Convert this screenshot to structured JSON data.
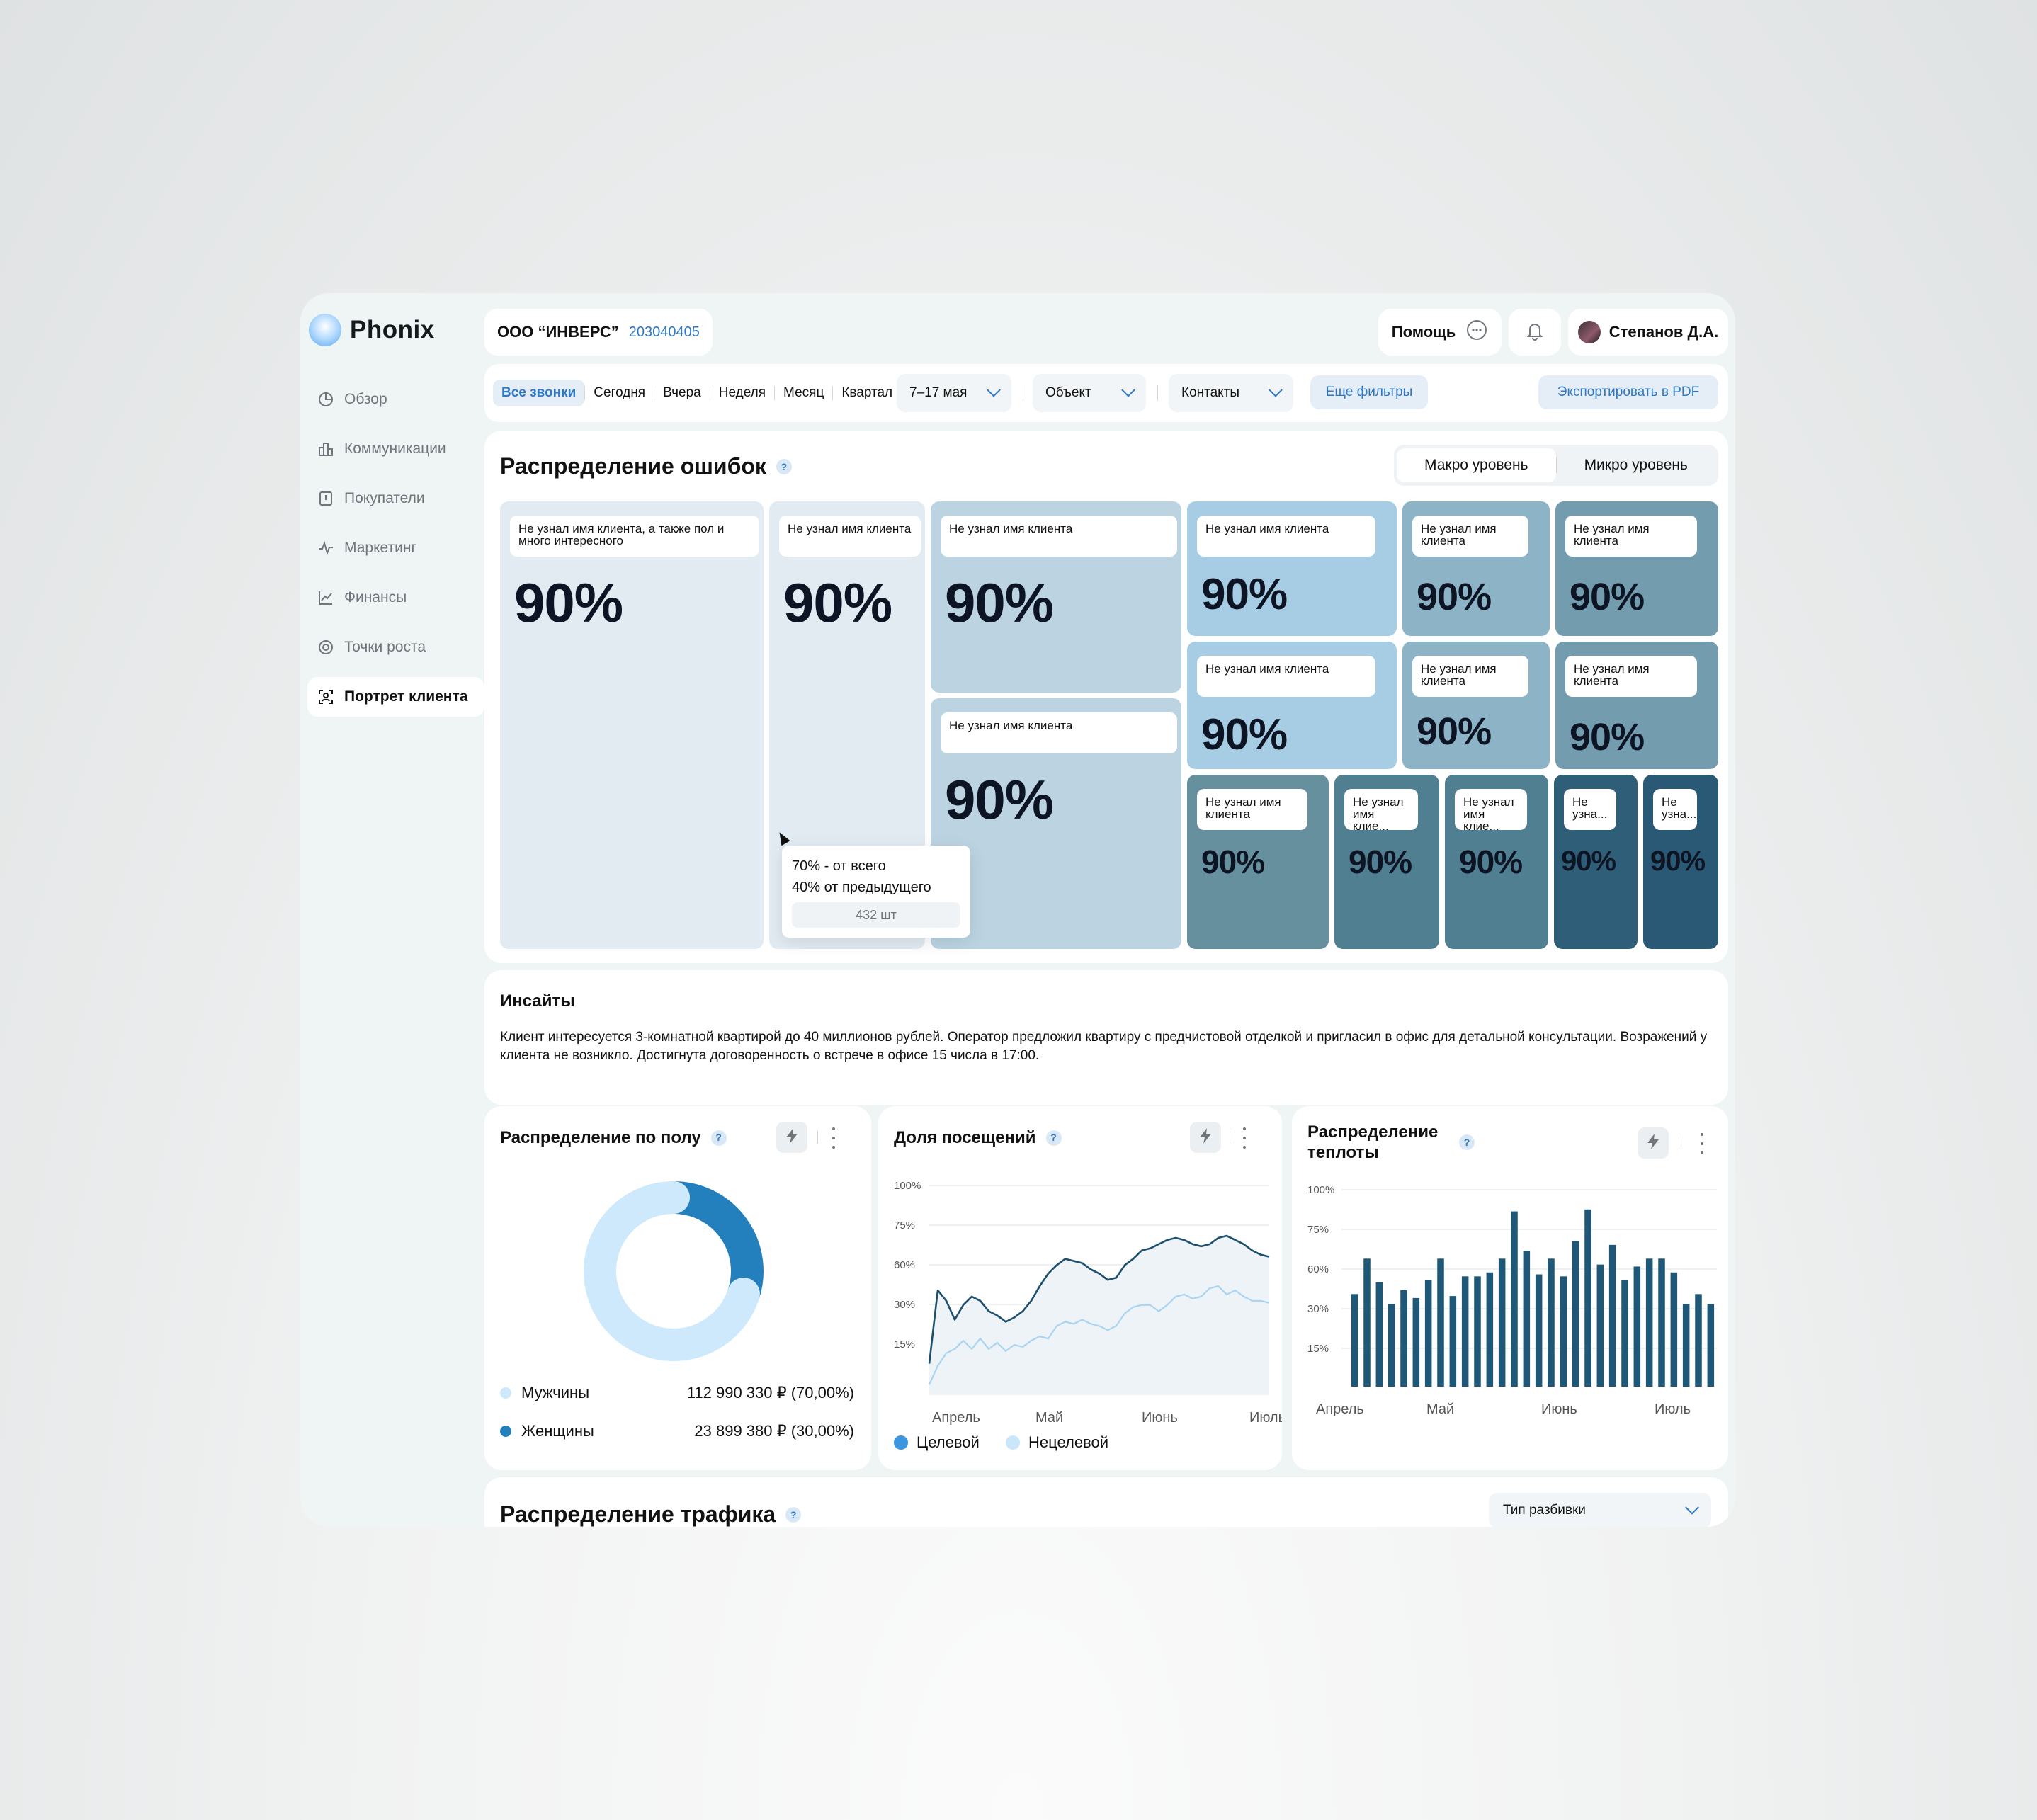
{
  "app": {
    "name": "Phonix"
  },
  "sidebar": {
    "items": [
      {
        "label": "Обзор",
        "icon": "pie-icon"
      },
      {
        "label": "Коммуникации",
        "icon": "buildings-icon"
      },
      {
        "label": "Покупатели",
        "icon": "book-icon"
      },
      {
        "label": "Маркетинг",
        "icon": "pulse-icon"
      },
      {
        "label": "Финансы",
        "icon": "trend-icon"
      },
      {
        "label": "Точки роста",
        "icon": "target-icon"
      },
      {
        "label": "Портрет клиента",
        "icon": "face-scan-icon",
        "active": true
      }
    ]
  },
  "header": {
    "company": "ООО “ИНВЕРС”",
    "inn": "203040405",
    "help": "Помощь",
    "user": "Степанов Д.А."
  },
  "filters": {
    "tabs": [
      "Все звонки",
      "Сегодня",
      "Вчера",
      "Неделя",
      "Месяц",
      "Квартал"
    ],
    "active_tab": "Все звонки",
    "date_range": "7–17 мая",
    "object": "Объект",
    "contacts": "Контакты",
    "more": "Еще фильтры",
    "export": "Экспортировать в PDF"
  },
  "errors": {
    "title": "Распределение ошибок",
    "levels": [
      "Макро уровень",
      "Микро уровень"
    ],
    "active_level": "Макро уровень",
    "tiles": [
      {
        "label": "Не узнал имя клиента, а также пол и много интересного",
        "value": "90%",
        "color": "#e1ebf1"
      },
      {
        "label": "Не узнал имя клиента",
        "value": "90%",
        "color": "#e1ebf1"
      },
      {
        "label": "Не узнал имя клиента",
        "value": "90%",
        "color": "#bcd4e2"
      },
      {
        "label": "Не узнал имя клиента",
        "value": "90%",
        "color": "#bcd4e2"
      },
      {
        "label": "Не узнал имя клиента",
        "value": "90%",
        "color": "#a6cde3"
      },
      {
        "label": "Не узнал имя клиента",
        "value": "90%",
        "color": "#8db3c6"
      },
      {
        "label": "Не узнал имя клиента",
        "value": "90%",
        "color": "#739dae"
      },
      {
        "label": "Не узнал имя клиента",
        "value": "90%",
        "color": "#a6cde3"
      },
      {
        "label": "Не узнал имя клиента",
        "value": "90%",
        "color": "#8db3c6"
      },
      {
        "label": "Не узнал имя клиента",
        "value": "90%",
        "color": "#739dae"
      },
      {
        "label": "Не узнал имя клиента",
        "value": "90%",
        "color": "#67909f"
      },
      {
        "label": "Не узнал имя клие...",
        "value": "90%",
        "color": "#4f7f90"
      },
      {
        "label": "Не узнал имя клие...",
        "value": "90%",
        "color": "#4f7f90"
      },
      {
        "label": "Не узна...",
        "value": "90%",
        "color": "#2f5f78"
      },
      {
        "label": "Не узна...",
        "value": "90%",
        "color": "#2a5976"
      }
    ],
    "tooltip": {
      "line1": "70% - от всего",
      "line2": "40% от предыдущего",
      "count": "432 шт"
    }
  },
  "insights": {
    "title": "Инсайты",
    "text": "Клиент интересуется 3-комнатной квартирой до 40 миллионов рублей. Оператор предложил квартиру с предчистовой отделкой и пригласил в офис для детальной консультации. Возражений у клиента не возникло. Достигнута договоренность о встрече в офисе 15 числа в 17:00."
  },
  "gender": {
    "title": "Распределение по полу",
    "items": [
      {
        "label": "Мужчины",
        "value": "112 990 330 ₽ (70,00%)",
        "color": "#cde9fb"
      },
      {
        "label": "Женщины",
        "value": "23 899 380 ₽ (30,00%)",
        "color": "#2380bc"
      }
    ]
  },
  "visits": {
    "title": "Доля посещений",
    "legend": [
      {
        "label": "Целевой",
        "color": "#3b95df"
      },
      {
        "label": "Нецелевой",
        "color": "#c9e6fb"
      }
    ]
  },
  "warmth": {
    "title": "Распределение теплоты"
  },
  "traffic": {
    "title": "Распределение трафика",
    "split_type": "Тип разбивки"
  },
  "chart_data": [
    {
      "type": "pie",
      "title": "Распределение по полу",
      "categories": [
        "Мужчины",
        "Женщины"
      ],
      "values": [
        70,
        30
      ],
      "colors": [
        "#cde9fb",
        "#2380bc"
      ]
    },
    {
      "type": "line",
      "title": "Доля посещений",
      "ytick_labels": [
        "15%",
        "30%",
        "60%",
        "75%",
        "100%"
      ],
      "xtick_labels": [
        "Апрель",
        "Май",
        "Июнь",
        "Июль"
      ],
      "x": [
        0,
        1,
        2,
        3,
        4,
        5,
        6,
        7,
        8,
        9,
        10,
        11,
        12,
        13,
        14,
        15,
        16,
        17,
        18,
        19,
        20,
        21,
        22,
        23,
        24,
        25,
        26,
        27,
        28,
        29,
        30,
        31,
        32,
        33,
        34,
        35,
        36,
        37,
        38,
        39,
        40
      ],
      "series": [
        {
          "name": "Целевой",
          "color": "#1d4f6e",
          "values": [
            15,
            50,
            45,
            36,
            43,
            47,
            45,
            40,
            38,
            35,
            37,
            40,
            45,
            52,
            58,
            62,
            65,
            64,
            63,
            60,
            58,
            55,
            56,
            62,
            65,
            69,
            70,
            72,
            74,
            75,
            74,
            72,
            71,
            72,
            75,
            76,
            74,
            72,
            69,
            67,
            66
          ]
        },
        {
          "name": "Нецелевой",
          "color": "#a9d4f2",
          "values": [
            5,
            14,
            20,
            22,
            26,
            22,
            27,
            22,
            25,
            21,
            24,
            23,
            26,
            28,
            27,
            33,
            35,
            34,
            36,
            34,
            33,
            31,
            33,
            39,
            42,
            43,
            43,
            40,
            43,
            47,
            48,
            46,
            47,
            51,
            52,
            48,
            50,
            47,
            45,
            45,
            44
          ]
        }
      ]
    },
    {
      "type": "bar",
      "title": "Распределение теплоты",
      "ytick_labels": [
        "15%",
        "30%",
        "60%",
        "75%",
        "100%"
      ],
      "xtick_labels": [
        "Апрель",
        "Май",
        "Июнь",
        "Июль"
      ],
      "values": [
        47,
        65,
        53,
        42,
        49,
        45,
        54,
        65,
        46,
        56,
        56,
        58,
        65,
        89,
        69,
        57,
        65,
        56,
        74,
        90,
        62,
        72,
        54,
        61,
        65,
        65,
        58,
        42,
        47,
        42
      ],
      "color": "#1f5776"
    }
  ]
}
